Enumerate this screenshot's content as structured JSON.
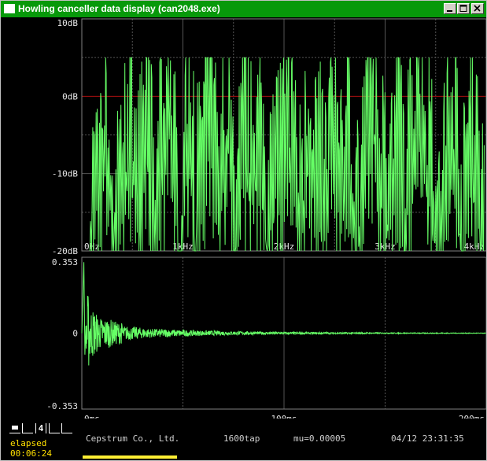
{
  "window": {
    "title": "Howling canceller data display (can2048.exe)",
    "buttons": [
      "minimize",
      "maximize",
      "close"
    ]
  },
  "colors": {
    "trace": "#66ff66",
    "grid": "#555555",
    "zero_line": "#b01010",
    "axis_text": "#e6e6e6",
    "status_text": "#cfcfcf",
    "elapsed_text": "#ffe000",
    "title_bar": "#07990a"
  },
  "spectrum": {
    "y_tick_labels": [
      "10dB",
      "0dB",
      "-10dB",
      "-20dB"
    ],
    "x_tick_labels": [
      "0Hz",
      "1kHz",
      "2kHz",
      "3kHz",
      "4kHz"
    ]
  },
  "impulse": {
    "y_tick_labels": [
      "0.353",
      "0",
      "-0.353"
    ],
    "x_tick_labels": [
      "0ms",
      "100ms",
      "200ms"
    ]
  },
  "chart_data": [
    {
      "type": "line",
      "title": "",
      "xlabel": "",
      "ylabel": "",
      "x_unit": "Hz",
      "y_unit": "dB",
      "xlim": [
        0,
        4000
      ],
      "ylim": [
        -20,
        10
      ],
      "grid": true,
      "x": [
        0,
        80,
        160,
        240,
        320,
        400,
        480,
        560,
        640,
        720,
        800,
        880,
        960,
        1040,
        1120,
        1200,
        1280,
        1360,
        1440,
        1520,
        1600,
        1680,
        1760,
        1840,
        1920,
        2000,
        2080,
        2160,
        2240,
        2320,
        2400,
        2480,
        2560,
        2640,
        2720,
        2800,
        2880,
        2960,
        3040,
        3120,
        3200,
        3280,
        3360,
        3440,
        3520,
        3600,
        3680,
        3760,
        3840,
        3920,
        4000
      ],
      "series": [
        {
          "name": "",
          "values": [
            -20,
            -12,
            -5,
            2,
            -14,
            -4,
            0,
            -8,
            1,
            -12,
            -3,
            4,
            -15,
            3,
            -10,
            -2,
            2,
            -9,
            3,
            -14,
            0,
            -6,
            -1,
            -12,
            -3,
            -5,
            2,
            -11,
            -1,
            -4,
            -9,
            3,
            -7,
            0,
            -13,
            -2,
            4,
            -6,
            -8,
            1,
            -10,
            0,
            3,
            -5,
            -14,
            -3,
            2,
            -12,
            -1,
            -6,
            -18
          ]
        }
      ]
    },
    {
      "type": "line",
      "title": "",
      "xlabel": "",
      "ylabel": "",
      "x_unit": "ms",
      "xlim": [
        0,
        200
      ],
      "ylim": [
        -0.353,
        0.353
      ],
      "grid": true,
      "x": [
        0,
        1,
        2,
        3,
        4,
        6,
        8,
        10,
        13,
        16,
        20,
        25,
        30,
        35,
        40,
        50,
        60,
        70,
        80,
        90,
        100,
        120,
        140,
        160,
        180,
        200
      ],
      "series": [
        {
          "name": "",
          "values": [
            0,
            0.33,
            -0.1,
            0.14,
            -0.09,
            0.08,
            -0.06,
            0.05,
            -0.05,
            0.04,
            -0.035,
            0.03,
            -0.025,
            0.02,
            -0.02,
            0.015,
            -0.012,
            0.01,
            -0.008,
            0.006,
            -0.005,
            0.004,
            -0.003,
            0.002,
            -0.002,
            0.001
          ]
        }
      ]
    }
  ],
  "controls": {
    "selector_value": "4",
    "elapsed_label": "elapsed",
    "elapsed_time": "00:06:24"
  },
  "status": {
    "company": "Cepstrum Co., Ltd.",
    "taps": "1600tap",
    "mu": "mu=0.00005",
    "datetime": "04/12 23:31:35"
  }
}
